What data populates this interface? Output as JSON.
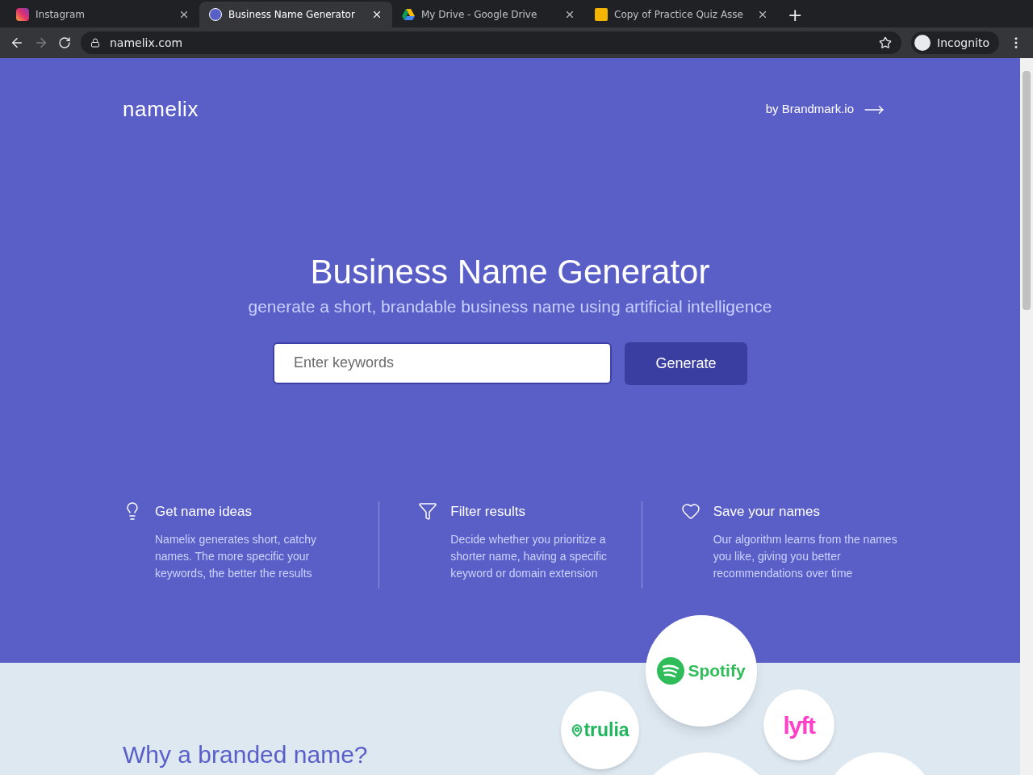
{
  "browser": {
    "tabs": [
      {
        "title": "Instagram",
        "kind": "instagram",
        "selected": false
      },
      {
        "title": "Business Name Generator",
        "kind": "site",
        "selected": true
      },
      {
        "title": "My Drive - Google Drive",
        "kind": "drive",
        "selected": false
      },
      {
        "title": "Copy of Practice Quiz Asse",
        "kind": "slides",
        "selected": false
      }
    ],
    "new_tab": "+",
    "url": "namelix.com",
    "profile": "Incognito"
  },
  "header": {
    "logo": "namelix",
    "by_link": "by Brandmark.io"
  },
  "hero": {
    "title": "Business Name Generator",
    "subtitle": "generate a short, brandable business name using artificial intelligence",
    "search": {
      "placeholder": "Enter keywords"
    },
    "button": "Generate"
  },
  "features": [
    {
      "kind": "ideas",
      "title": "Get name ideas",
      "text": "Namelix generates short, catchy names. The more specific your keywords, the better the results"
    },
    {
      "kind": "filter",
      "title": "Filter results",
      "text": "Decide whether you prioritize a shorter name, having a specific keyword or domain extension"
    },
    {
      "kind": "save",
      "title": "Save your names",
      "text": "Our algorithm learns from the names you like, giving you better recommendations over time"
    }
  ],
  "why": {
    "heading": "Why a branded name?"
  },
  "brands": [
    {
      "name": "Spotify",
      "color": "#2ebd59"
    },
    {
      "name": "trulia",
      "color": "#1fb55c"
    },
    {
      "name": "lyft",
      "color": "#ff3fc8"
    }
  ]
}
